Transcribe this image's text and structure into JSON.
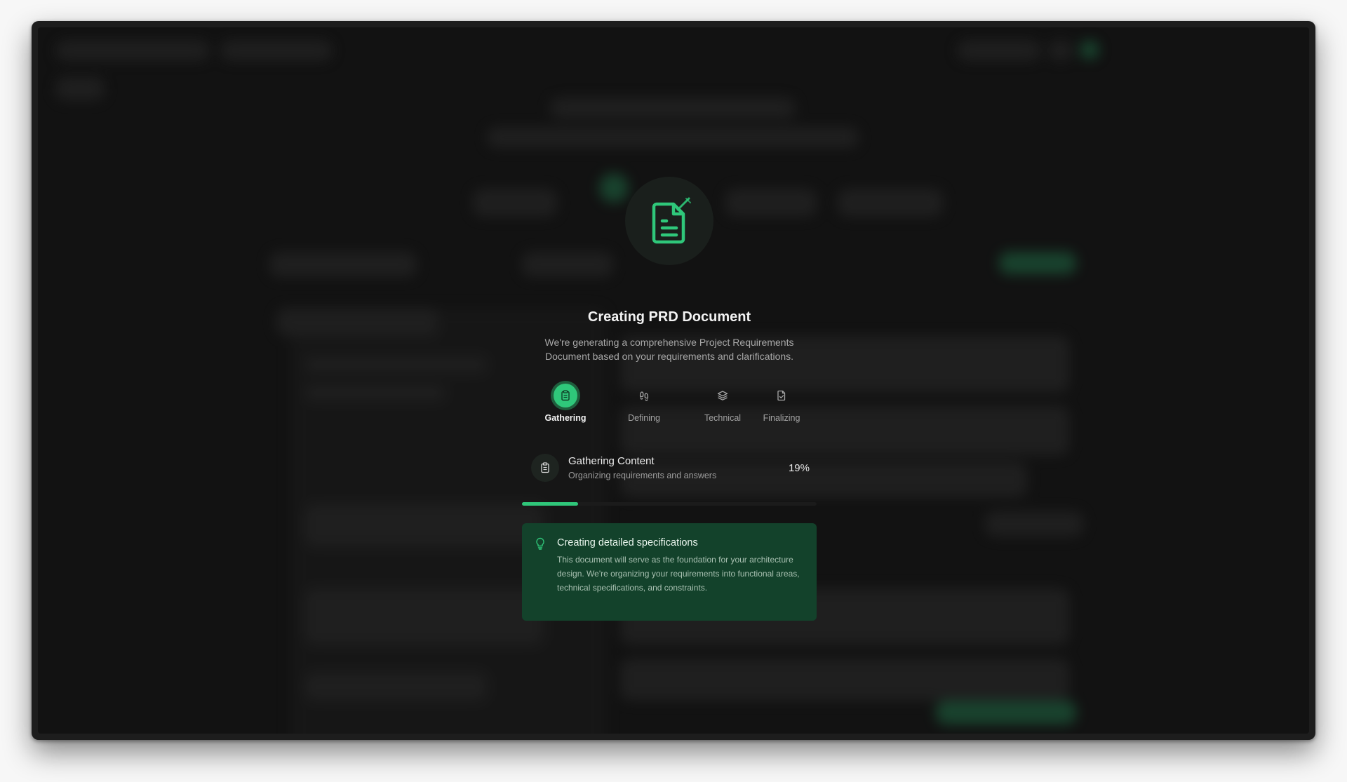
{
  "modal": {
    "title": "Creating PRD Document",
    "subtitle": "We're generating a comprehensive Project Requirements Document based on your requirements and clarifications.",
    "hero_icon": "document-edit-icon",
    "steps": [
      {
        "label": "Gathering",
        "icon": "clipboard-icon",
        "active": true
      },
      {
        "label": "Defining",
        "icon": "footprints-icon",
        "active": false
      },
      {
        "label": "Technical",
        "icon": "layers-icon",
        "active": false
      },
      {
        "label": "Finalizing",
        "icon": "file-check-icon",
        "active": false
      }
    ],
    "status": {
      "title": "Gathering Content",
      "subtitle": "Organizing requirements and answers",
      "percent_label": "19%",
      "progress": 0.19
    },
    "tip": {
      "icon": "lightbulb-icon",
      "title": "Creating detailed specifications",
      "body": "This document will serve as the foundation for your architecture design. We're organizing your requirements into functional areas, technical specifications, and constraints."
    }
  },
  "colors": {
    "accent": "#2fc77a",
    "tip_background": "#13422b",
    "background": "#121212"
  }
}
